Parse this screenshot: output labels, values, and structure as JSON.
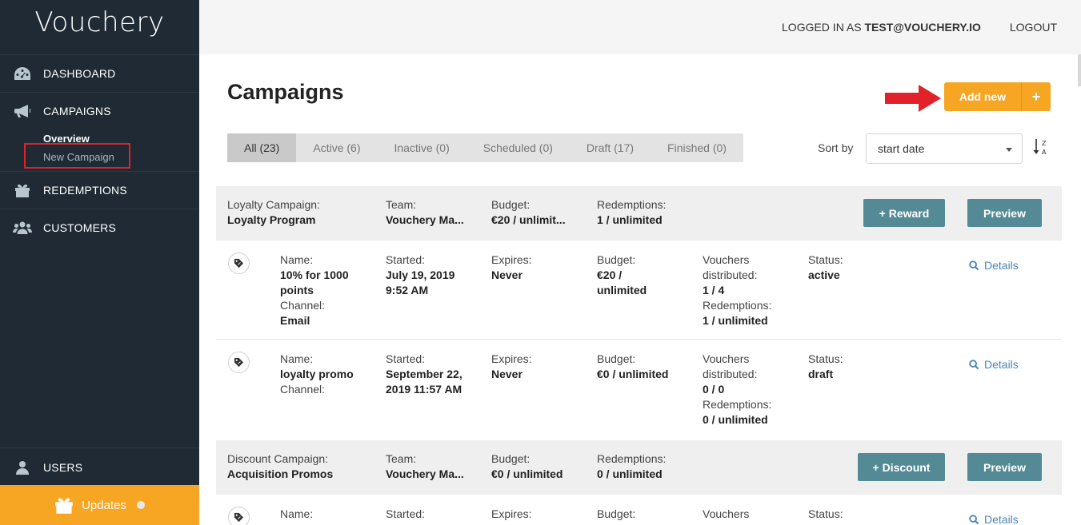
{
  "app": {
    "logo": "Vouchery"
  },
  "sidebar": {
    "items": [
      {
        "label": "DASHBOARD",
        "icon": "dashboard-icon"
      },
      {
        "label": "CAMPAIGNS",
        "icon": "megaphone-icon"
      },
      {
        "label": "REDEMPTIONS",
        "icon": "gift-icon"
      },
      {
        "label": "CUSTOMERS",
        "icon": "users-group-icon"
      }
    ],
    "campaigns_sub": {
      "overview": "Overview",
      "new_campaign": "New Campaign"
    },
    "users": "USERS",
    "updates": "Updates"
  },
  "header": {
    "logged_in_prefix": "LOGGED IN AS",
    "user": "TEST@VOUCHERY.IO",
    "logout": "LOGOUT"
  },
  "main": {
    "title": "Campaigns",
    "add_new": "Add new",
    "add_plus": "+",
    "tabs": [
      "All (23)",
      "Active (6)",
      "Inactive (0)",
      "Scheduled (0)",
      "Draft (17)",
      "Finished (0)"
    ],
    "sort_label": "Sort by",
    "sort_value": "start date",
    "labels": {
      "team": "Team:",
      "budget": "Budget:",
      "redemptions": "Redemptions:",
      "name": "Name:",
      "channel": "Channel:",
      "started": "Started:",
      "expires": "Expires:",
      "vouchers": "Vouchers",
      "distributed": "distributed:",
      "status": "Status:",
      "details": "Details",
      "preview": "Preview"
    },
    "campaigns": [
      {
        "type_label": "Loyalty Campaign:",
        "name": "Loyalty Program",
        "team": "Vouchery Ma...",
        "budget": "€20 / unlimit...",
        "redemptions": "1 / unlimited",
        "action": "+ Reward",
        "rewards": [
          {
            "name_line1": "10% for 1000",
            "name_line2": "points",
            "channel": "Email",
            "started_line1": "July 19, 2019",
            "started_line2": "9:52 AM",
            "expires": "Never",
            "budget_line1": "€20 /",
            "budget_line2": "unlimited",
            "vouchers": "1 / 4",
            "redemptions": "1 / unlimited",
            "status": "active"
          },
          {
            "name_line1": "loyalty promo",
            "channel": "",
            "started_line1": "September 22,",
            "started_line2": "2019 11:57 AM",
            "expires": "Never",
            "budget_line1": "€0 / unlimited",
            "vouchers": "0 / 0",
            "redemptions": "0 / unlimited",
            "status": "draft"
          }
        ]
      },
      {
        "type_label": "Discount Campaign:",
        "name": "Acquisition Promos",
        "team": "Vouchery Ma...",
        "budget": "€0 / unlimited",
        "redemptions": "0 / unlimited",
        "action": "+ Discount"
      }
    ]
  },
  "colors": {
    "sidebar": "#1f2a35",
    "accent": "#f6a623",
    "teal": "#548a96",
    "link": "#4a86b8",
    "annotation": "#e1222b"
  }
}
